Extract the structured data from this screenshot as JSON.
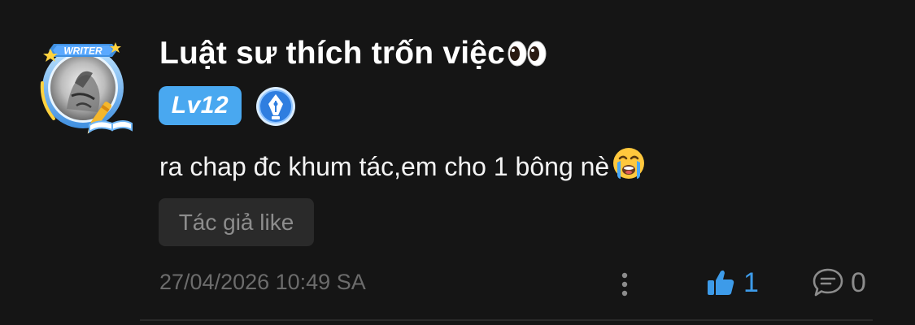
{
  "comment": {
    "avatar": {
      "frame_label": "WRITER",
      "icon": "writer-avatar-frame"
    },
    "username": "Luật sư thích trốn việc",
    "username_emoji": "eyes-emoji",
    "level_badge": "Lv12",
    "pen_badge_icon": "fountain-pen-icon",
    "text": "ra chap đc khum tác,em cho 1 bông nè",
    "text_emoji": "loudly-crying-face-emoji",
    "author_like_label": "Tác giả like",
    "timestamp": "27/04/2026 10:49 SA",
    "like_count": "1",
    "reply_count": "0",
    "colors": {
      "background": "#151515",
      "accent_blue": "#49a8f0",
      "muted_text": "#6c6c6c",
      "chip_bg": "#2a2a2a"
    }
  }
}
